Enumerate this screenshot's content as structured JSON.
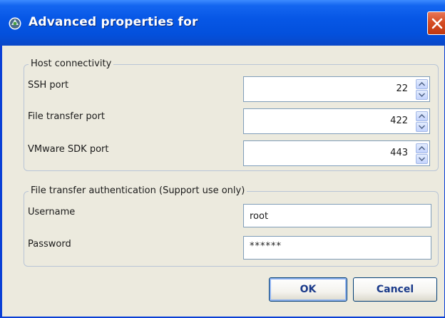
{
  "window": {
    "title": "Advanced properties for",
    "icon": "app-logo-icon",
    "close_icon": "close-icon"
  },
  "host_connectivity": {
    "legend": "Host connectivity",
    "ssh_port": {
      "label": "SSH port",
      "value": "22"
    },
    "file_transfer_port": {
      "label": "File transfer port",
      "value": "422"
    },
    "vmware_sdk_port": {
      "label": "VMware SDK port",
      "value": "443"
    }
  },
  "auth": {
    "legend": "File transfer authentication (Support use only)",
    "username": {
      "label": "Username",
      "value": "root"
    },
    "password": {
      "label": "Password",
      "value": "******"
    }
  },
  "buttons": {
    "ok": "OK",
    "cancel": "Cancel"
  },
  "colors": {
    "titlebar": "#0350dc",
    "close": "#d64d24",
    "dialog_bg": "#eceade",
    "button_text": "#1a3a8a"
  }
}
